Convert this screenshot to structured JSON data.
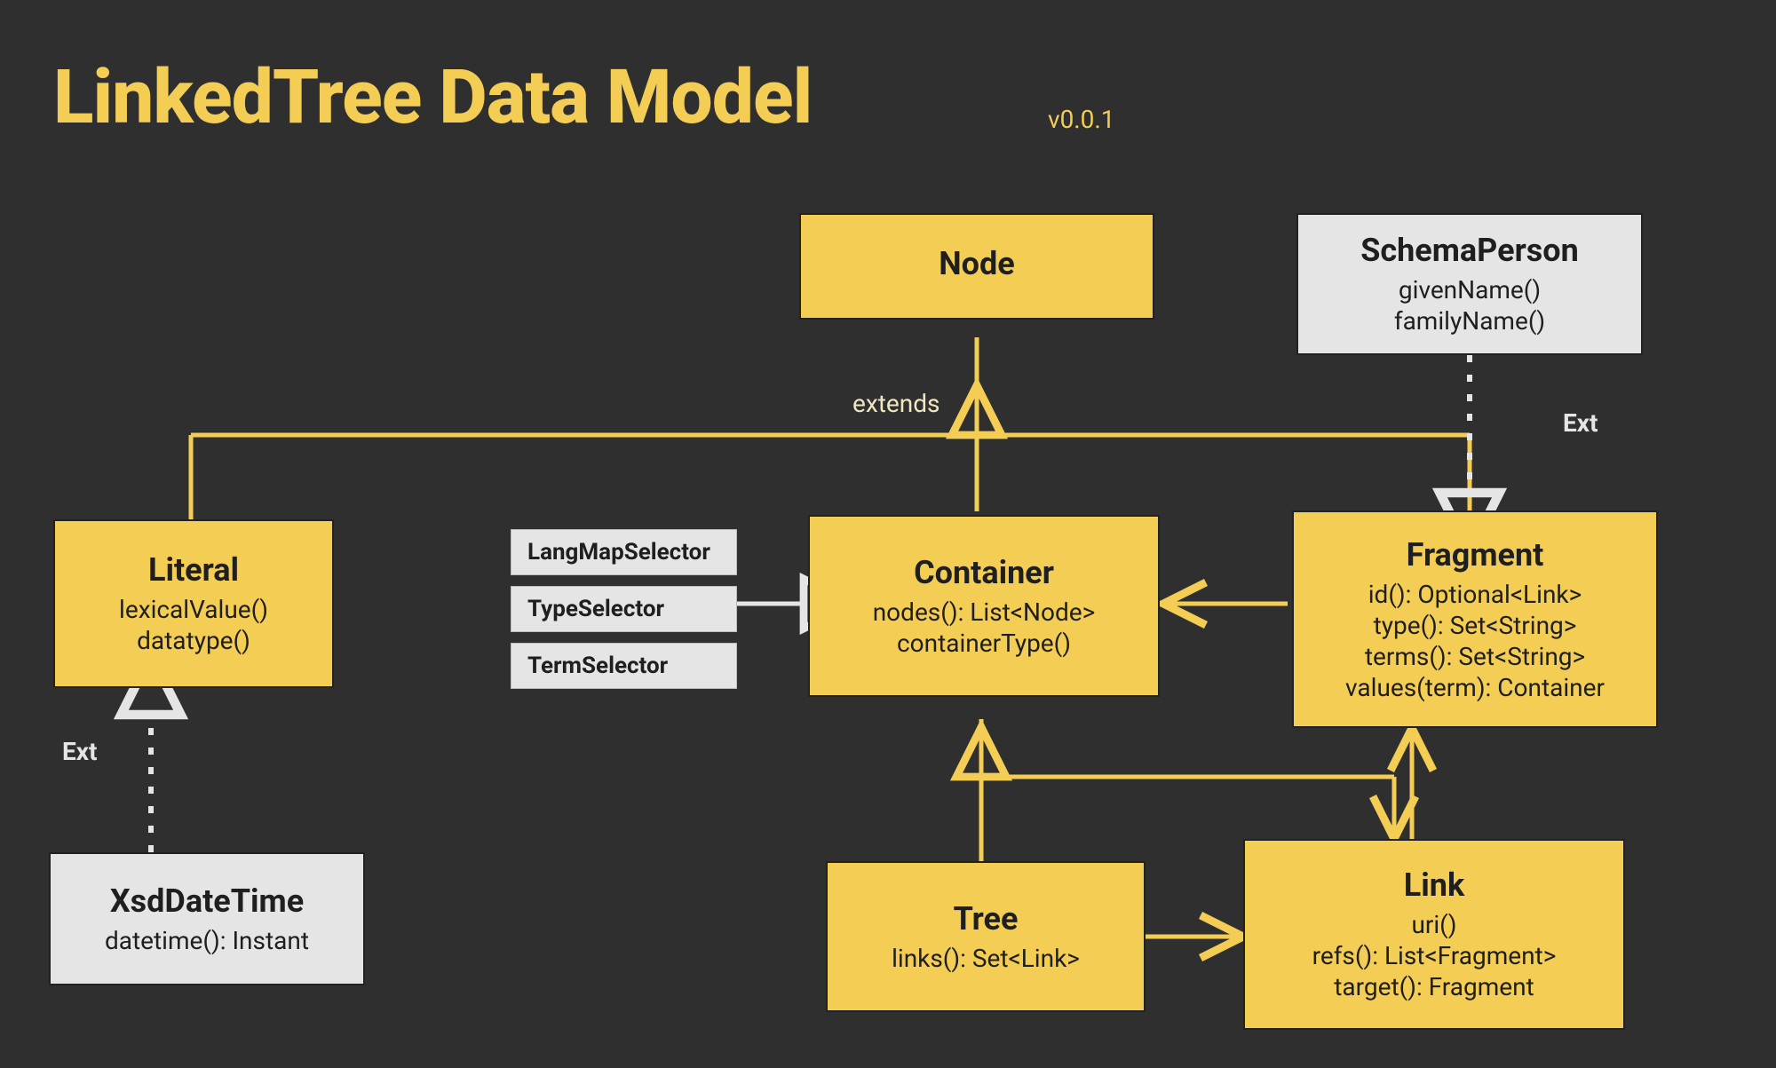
{
  "title": "LinkedTree Data Model",
  "version": "v0.0.1",
  "labels": {
    "extends": "extends",
    "ext1": "Ext",
    "ext2": "Ext"
  },
  "selectors": {
    "langmap": "LangMapSelector",
    "type": "TypeSelector",
    "term": "TermSelector"
  },
  "boxes": {
    "node": {
      "name": "Node"
    },
    "schemaPerson": {
      "name": "SchemaPerson",
      "lines": [
        "givenName()",
        "familyName()"
      ]
    },
    "literal": {
      "name": "Literal",
      "lines": [
        "lexicalValue()",
        "datatype()"
      ]
    },
    "container": {
      "name": "Container",
      "lines": [
        "nodes(): List<Node>",
        "containerType()"
      ]
    },
    "fragment": {
      "name": "Fragment",
      "lines": [
        "id(): Optional<Link>",
        "type(): Set<String>",
        "terms(): Set<String>",
        "values(term): Container"
      ]
    },
    "xsdDateTime": {
      "name": "XsdDateTime",
      "lines": [
        "datetime(): Instant"
      ]
    },
    "tree": {
      "name": "Tree",
      "lines": [
        "links(): Set<Link>"
      ]
    },
    "link": {
      "name": "Link",
      "lines": [
        "uri()",
        "refs(): List<Fragment>",
        "target(): Fragment"
      ]
    }
  }
}
